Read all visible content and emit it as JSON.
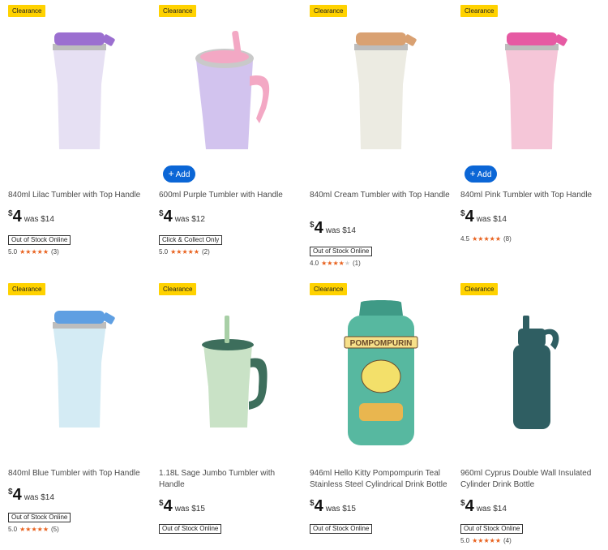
{
  "products": [
    {
      "badge": "Clearance",
      "name": "840ml Lilac Tumbler with Top Handle",
      "price_symbol": "$",
      "price": "4",
      "was": "was $14",
      "stock": "Out of Stock Online",
      "rating": "5.0",
      "stars": 5,
      "reviews": "(3)",
      "add_label": "",
      "colors": {
        "body": "#e6e0f3",
        "lid": "#9b6fd0"
      }
    },
    {
      "badge": "Clearance",
      "name": "600ml Purple Tumbler with Handle",
      "price_symbol": "$",
      "price": "4",
      "was": "was $12",
      "stock": "Click & Collect Only",
      "rating": "5.0",
      "stars": 5,
      "reviews": "(2)",
      "add_label": "Add",
      "colors": {
        "body": "#d2c3ee",
        "lid": "#f3a8c4"
      }
    },
    {
      "badge": "Clearance",
      "name": "840ml Cream Tumbler with Top Handle",
      "price_symbol": "$",
      "price": "4",
      "was": "was $14",
      "stock": "Out of Stock Online",
      "rating": "4.0",
      "stars": 4,
      "reviews": "(1)",
      "add_label": "",
      "colors": {
        "body": "#ecebe2",
        "lid": "#d9a172"
      }
    },
    {
      "badge": "Clearance",
      "name": "840ml Pink Tumbler with Top Handle",
      "price_symbol": "$",
      "price": "4",
      "was": "was $14",
      "stock": "",
      "rating": "4.5",
      "stars": 4.5,
      "reviews": "(8)",
      "add_label": "Add",
      "colors": {
        "body": "#f5c6d8",
        "lid": "#e65aa3"
      }
    },
    {
      "badge": "Clearance",
      "name": "840ml Blue Tumbler with Top Handle",
      "price_symbol": "$",
      "price": "4",
      "was": "was $14",
      "stock": "Out of Stock Online",
      "rating": "5.0",
      "stars": 5,
      "reviews": "(5)",
      "add_label": "",
      "colors": {
        "body": "#d4ebf4",
        "lid": "#5f9fe2"
      }
    },
    {
      "badge": "Clearance",
      "name": "1.18L Sage Jumbo Tumbler with Handle",
      "price_symbol": "$",
      "price": "4",
      "was": "was $15",
      "stock": "Out of Stock Online",
      "rating": "",
      "stars": 0,
      "reviews": "",
      "add_label": "",
      "colors": {
        "body": "#c9e2c6",
        "lid": "#3d6e5c"
      }
    },
    {
      "badge": "Clearance",
      "name": "946ml Hello Kitty Pompompurin Teal Stainless Steel Cylindrical Drink Bottle",
      "price_symbol": "$",
      "price": "4",
      "was": "was $15",
      "stock": "Out of Stock Online",
      "rating": "",
      "stars": 0,
      "reviews": "",
      "add_label": "",
      "bottle_text": "POMPOMPURIN",
      "colors": {
        "body": "#57b8a0",
        "lid": "#3f9a86"
      }
    },
    {
      "badge": "Clearance",
      "name": "960ml Cyprus Double Wall Insulated Cylinder Drink Bottle",
      "price_symbol": "$",
      "price": "4",
      "was": "was $14",
      "stock": "Out of Stock Online",
      "rating": "5.0",
      "stars": 5,
      "reviews": "(4)",
      "add_label": "",
      "colors": {
        "body": "#2f5e62",
        "lid": "#2f5e62"
      }
    }
  ]
}
